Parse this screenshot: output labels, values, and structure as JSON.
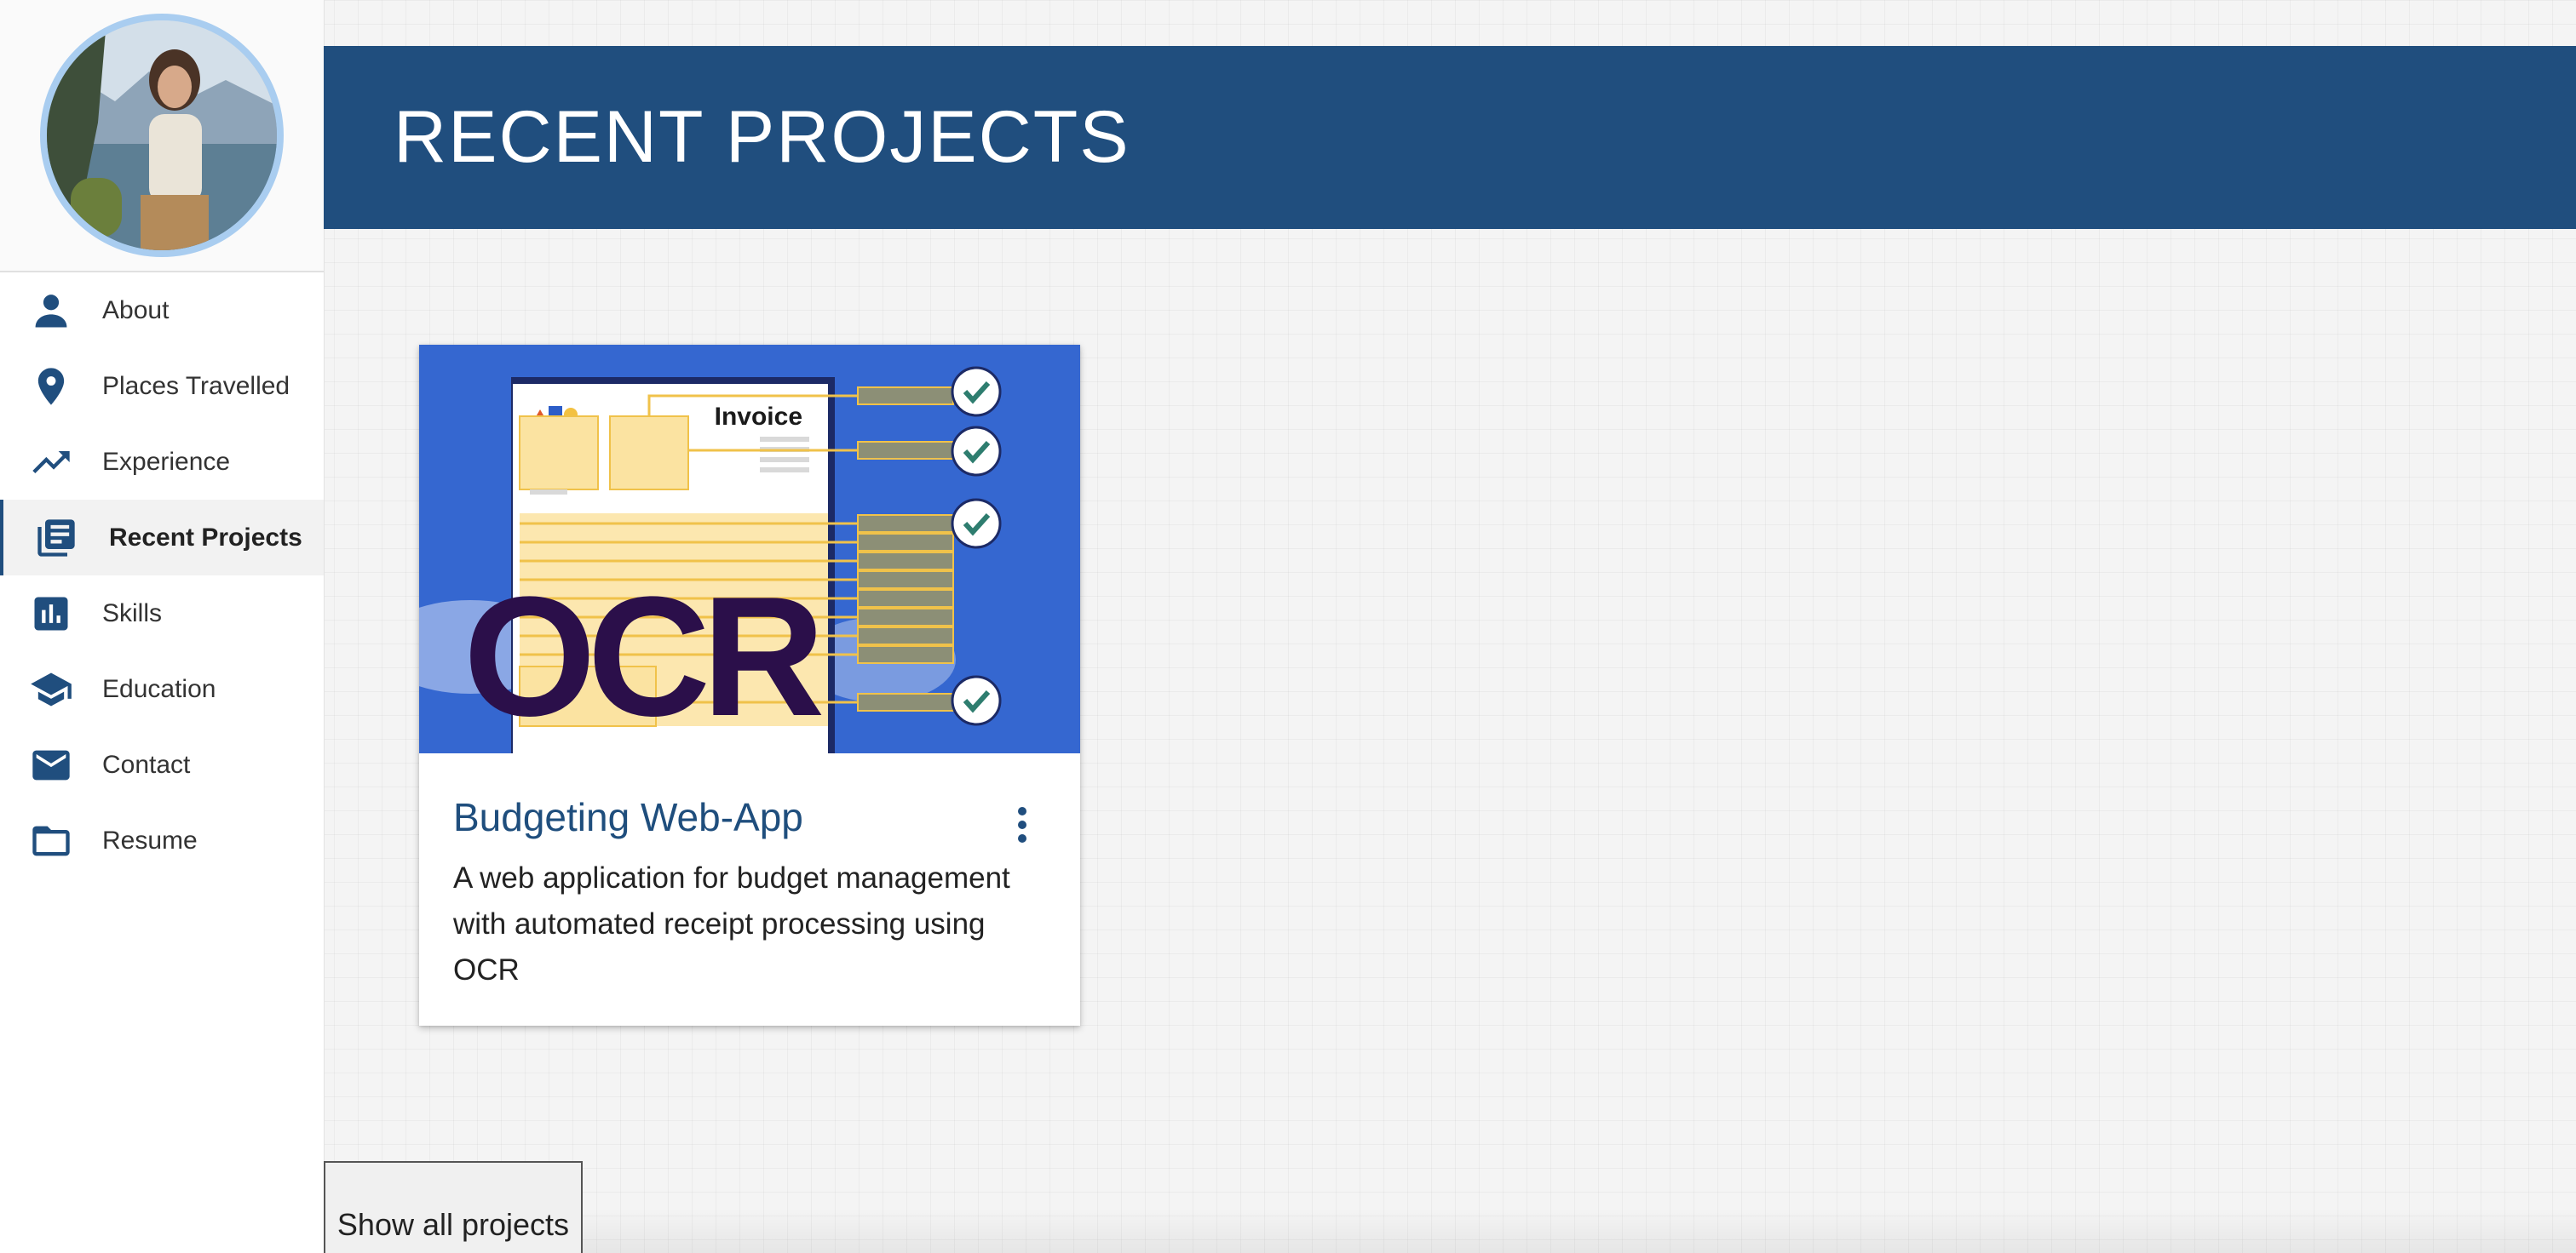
{
  "sidebar": {
    "items": [
      {
        "label": "About",
        "icon": "person-icon"
      },
      {
        "label": "Places Travelled",
        "icon": "location-pin-icon"
      },
      {
        "label": "Experience",
        "icon": "trending-up-icon"
      },
      {
        "label": "Recent Projects",
        "icon": "library-books-icon",
        "active": true
      },
      {
        "label": "Skills",
        "icon": "bar-chart-icon"
      },
      {
        "label": "Education",
        "icon": "graduation-cap-icon"
      },
      {
        "label": "Contact",
        "icon": "mail-icon"
      },
      {
        "label": "Resume",
        "icon": "folder-icon"
      }
    ]
  },
  "header": {
    "title": "RECENT PROJECTS"
  },
  "projects": [
    {
      "title": "Budgeting Web-App",
      "description": "A web application for budget management with automated receipt processing using OCR",
      "image": {
        "doc_heading": "Invoice",
        "overlay_text": "OCR"
      }
    }
  ],
  "actions": {
    "show_all": "Show all projects"
  },
  "colors": {
    "primary": "#204e7e",
    "avatar_ring": "#a9cdf0",
    "card_image_bg": "#3567d0",
    "ocr_text": "#2b0f4a"
  }
}
